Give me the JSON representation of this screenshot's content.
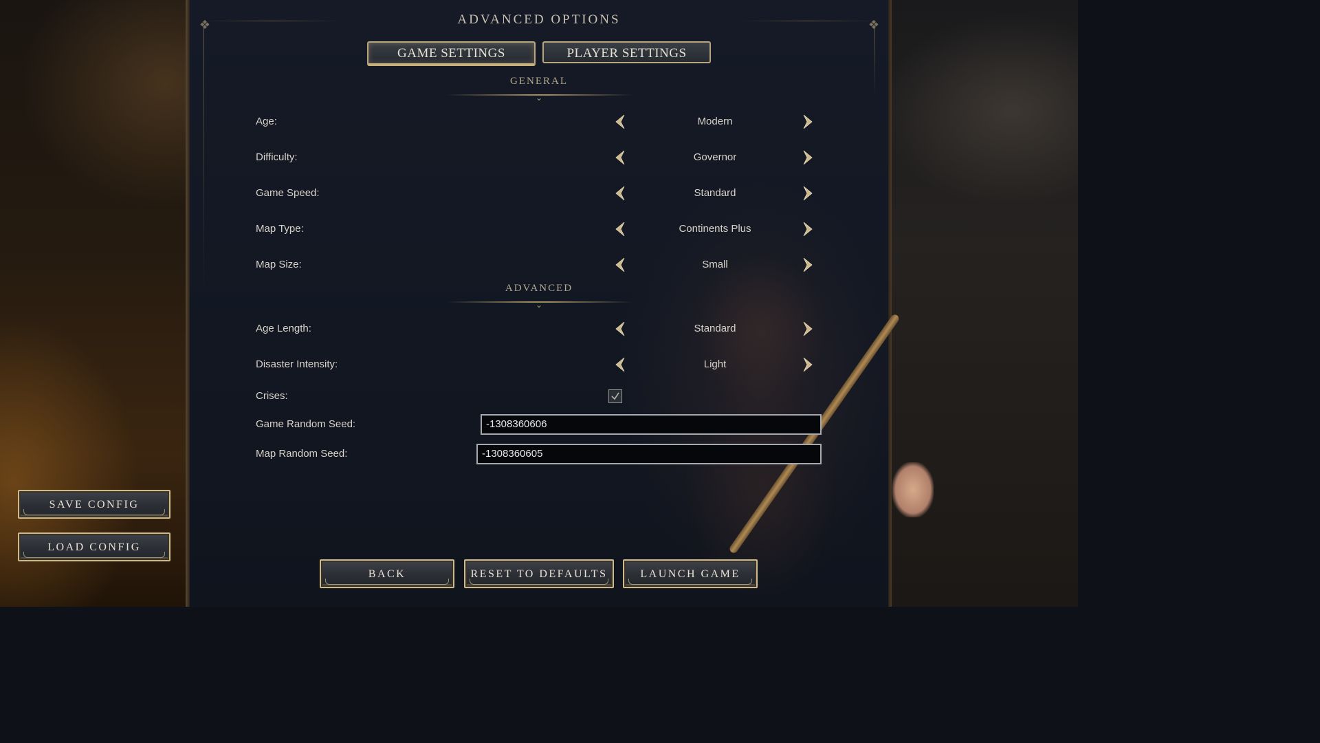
{
  "title": "ADVANCED OPTIONS",
  "tabs": [
    {
      "label": "GAME SETTINGS",
      "active": true
    },
    {
      "label": "PLAYER SETTINGS",
      "active": false
    }
  ],
  "sections": {
    "general": "GENERAL",
    "advanced": "ADVANCED"
  },
  "general_options": [
    {
      "label": "Age:",
      "value": "Modern"
    },
    {
      "label": "Difficulty:",
      "value": "Governor"
    },
    {
      "label": "Game Speed:",
      "value": "Standard"
    },
    {
      "label": "Map Type:",
      "value": "Continents Plus"
    },
    {
      "label": "Map Size:",
      "value": "Small"
    }
  ],
  "advanced_options": [
    {
      "label": "Age Length:",
      "value": "Standard"
    },
    {
      "label": "Disaster Intensity:",
      "value": "Light"
    }
  ],
  "crises": {
    "label": "Crises:",
    "checked": true
  },
  "game_seed": {
    "label": "Game Random Seed:",
    "value": "-1308360606"
  },
  "map_seed": {
    "label": "Map Random Seed:",
    "value": "-1308360605"
  },
  "side_buttons": {
    "save_config": "SAVE CONFIG",
    "load_config": "LOAD CONFIG"
  },
  "bottom_buttons": {
    "back": "BACK",
    "reset": "RESET TO DEFAULTS",
    "launch": "LAUNCH GAME"
  },
  "icons": {
    "prev": "chevron-left-icon",
    "next": "chevron-right-icon",
    "check": "checkmark-icon"
  },
  "colors": {
    "accent_gold": "#cdb98c",
    "panel_bg": "#131823"
  }
}
